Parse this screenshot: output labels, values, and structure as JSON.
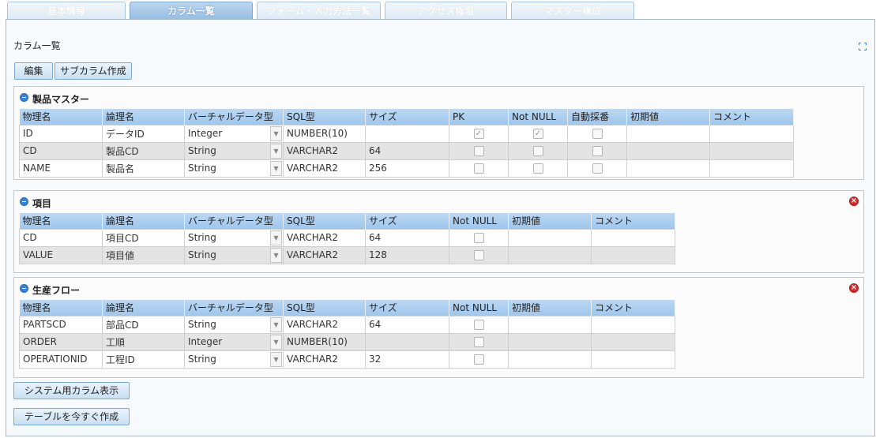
{
  "tabs": [
    {
      "label": "基本情報",
      "active": false
    },
    {
      "label": "カラム一覧",
      "active": true
    },
    {
      "label": "フォーム・入力方法一覧",
      "active": false
    },
    {
      "label": "アクセス権限",
      "active": false
    },
    {
      "label": "マスター構成",
      "active": false
    }
  ],
  "page_title": "カラム一覧",
  "toolbar": {
    "edit_label": "編集",
    "sub_column_label": "サブカラム作成"
  },
  "tables": [
    {
      "title": "製品マスター",
      "deletable": false,
      "headers": [
        "物理名",
        "論理名",
        "バーチャルデータ型",
        "SQL型",
        "サイズ",
        "PK",
        "Not NULL",
        "自動採番",
        "初期値",
        "コメント"
      ],
      "rows": [
        {
          "physical": "ID",
          "logical": "データID",
          "vtype": "Integer",
          "sqltype": "NUMBER(10)",
          "size": "",
          "pk": true,
          "notnull": true,
          "autonum": false,
          "default": "",
          "comment": ""
        },
        {
          "physical": "CD",
          "logical": "製品CD",
          "vtype": "String",
          "sqltype": "VARCHAR2",
          "size": "64",
          "pk": false,
          "notnull": false,
          "autonum": false,
          "default": "",
          "comment": ""
        },
        {
          "physical": "NAME",
          "logical": "製品名",
          "vtype": "String",
          "sqltype": "VARCHAR2",
          "size": "256",
          "pk": false,
          "notnull": false,
          "autonum": false,
          "default": "",
          "comment": ""
        }
      ]
    },
    {
      "title": "項目",
      "deletable": true,
      "headers": [
        "物理名",
        "論理名",
        "バーチャルデータ型",
        "SQL型",
        "サイズ",
        "Not NULL",
        "初期値",
        "コメント"
      ],
      "rows": [
        {
          "physical": "CD",
          "logical": "項目CD",
          "vtype": "String",
          "sqltype": "VARCHAR2",
          "size": "64",
          "notnull": false,
          "default": "",
          "comment": ""
        },
        {
          "physical": "VALUE",
          "logical": "項目値",
          "vtype": "String",
          "sqltype": "VARCHAR2",
          "size": "128",
          "notnull": false,
          "default": "",
          "comment": ""
        }
      ]
    },
    {
      "title": "生産フロー",
      "deletable": true,
      "headers": [
        "物理名",
        "論理名",
        "バーチャルデータ型",
        "SQL型",
        "サイズ",
        "Not NULL",
        "初期値",
        "コメント"
      ],
      "rows": [
        {
          "physical": "PARTSCD",
          "logical": "部品CD",
          "vtype": "String",
          "sqltype": "VARCHAR2",
          "size": "64",
          "notnull": false,
          "default": "",
          "comment": ""
        },
        {
          "physical": "ORDER",
          "logical": "工順",
          "vtype": "Integer",
          "sqltype": "NUMBER(10)",
          "size": "",
          "notnull": false,
          "default": "",
          "comment": ""
        },
        {
          "physical": "OPERATIONID",
          "logical": "工程ID",
          "vtype": "String",
          "sqltype": "VARCHAR2",
          "size": "32",
          "notnull": false,
          "default": "",
          "comment": ""
        }
      ]
    }
  ],
  "footer": {
    "system_columns_label": "システム用カラム表示",
    "create_table_label": "テーブルを今すぐ作成"
  },
  "icons": {
    "collapse": "collapse-minus-icon",
    "delete": "delete-x-icon",
    "expand": "expand-fullscreen-icon",
    "dropdown": "chevron-down-icon",
    "check": "check-icon"
  },
  "colors": {
    "tab_active": "#96bde2",
    "header_blue": "#9ec6ec",
    "row_alt": "#e4e4e4",
    "delete_red": "#d62a2a",
    "collapse_blue": "#3b82d6"
  }
}
